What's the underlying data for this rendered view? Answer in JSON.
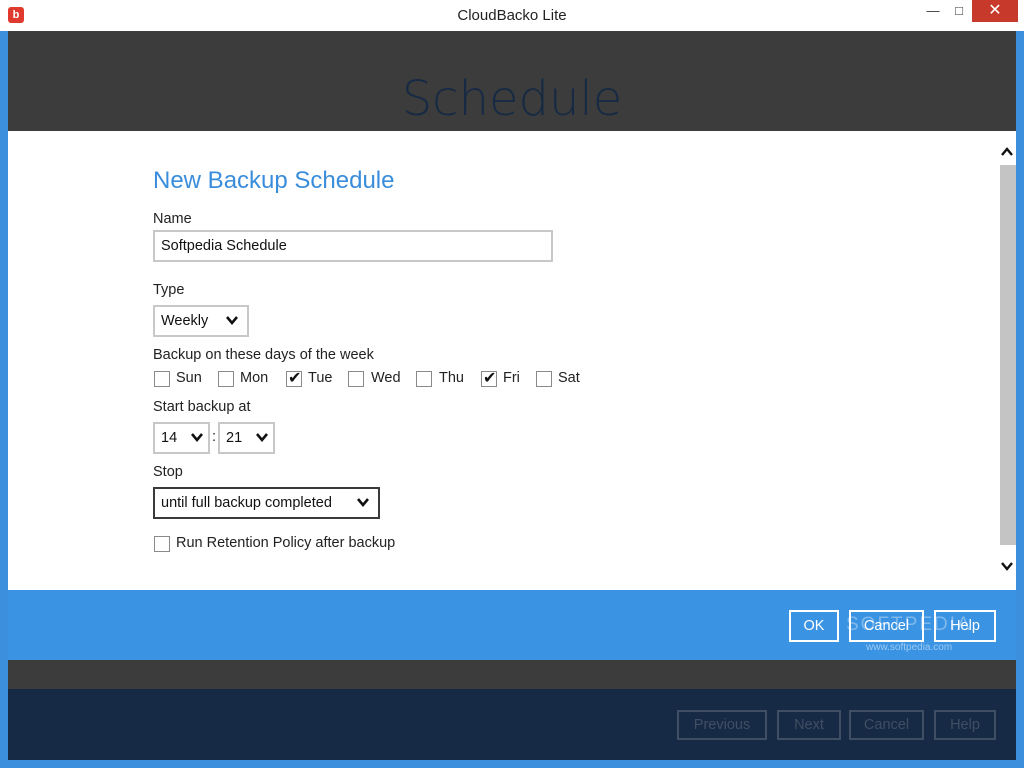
{
  "window": {
    "title": "CloudBacko Lite",
    "controls": {
      "minimize": "—",
      "maximize": "□",
      "close": "✕"
    }
  },
  "header": {
    "title": "Schedule"
  },
  "form": {
    "section_title": "New Backup Schedule",
    "name": {
      "label": "Name",
      "value": "Softpedia Schedule"
    },
    "type": {
      "label": "Type",
      "selected": "Weekly"
    },
    "days": {
      "label": "Backup on these days of the week",
      "items": [
        {
          "label": "Sun",
          "checked": false
        },
        {
          "label": "Mon",
          "checked": false
        },
        {
          "label": "Tue",
          "checked": true
        },
        {
          "label": "Wed",
          "checked": false
        },
        {
          "label": "Thu",
          "checked": false
        },
        {
          "label": "Fri",
          "checked": true
        },
        {
          "label": "Sat",
          "checked": false
        }
      ]
    },
    "start": {
      "label": "Start backup at",
      "hour": "14",
      "separator": ":",
      "minute": "21"
    },
    "stop": {
      "label": "Stop",
      "selected": "until full backup completed"
    },
    "retention": {
      "label": "Run Retention Policy after backup",
      "checked": false
    }
  },
  "dialog_buttons": {
    "ok": "OK",
    "cancel": "Cancel",
    "help": "Help"
  },
  "watermark": {
    "text": "SOFTPEDIA",
    "sub": "www.softpedia.com"
  },
  "nav_buttons": {
    "previous": "Previous",
    "next": "Next",
    "cancel": "Cancel",
    "help": "Help"
  },
  "colors": {
    "accent": "#3a93e3",
    "header_bg": "#3c3c3c",
    "footer_bg": "#172a45",
    "close_btn": "#c7392b"
  }
}
